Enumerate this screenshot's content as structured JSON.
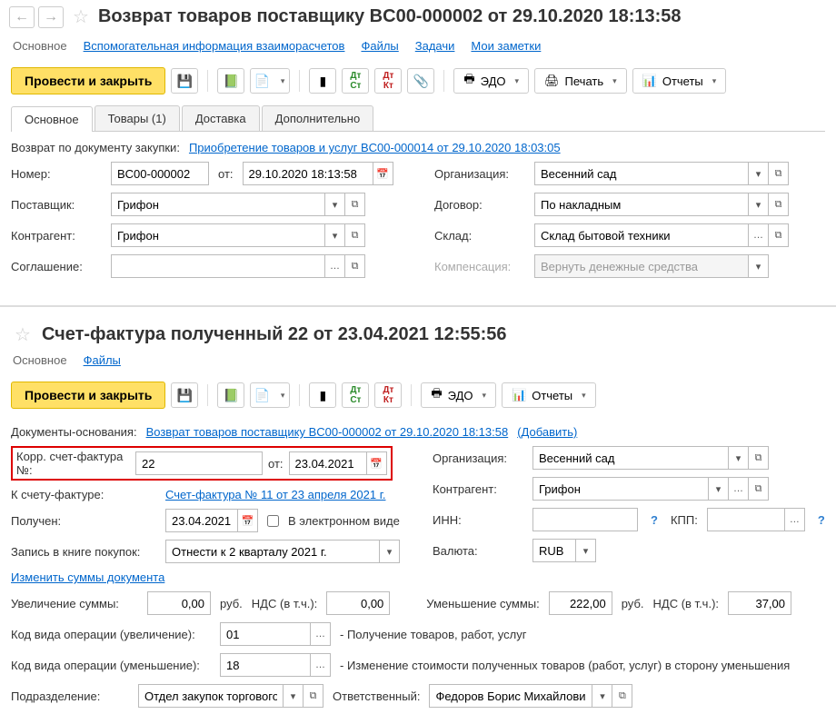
{
  "doc1": {
    "title": "Возврат товаров поставщику BC00-000002 от 29.10.2020 18:13:58",
    "hlinks": {
      "main": "Основное",
      "aux": "Вспомогательная информация взаиморасчетов",
      "files": "Файлы",
      "tasks": "Задачи",
      "notes": "Мои заметки"
    },
    "toolbar": {
      "postclose": "Провести и закрыть",
      "edo": "ЭДО",
      "print": "Печать",
      "reports": "Отчеты"
    },
    "tabs": {
      "main": "Основное",
      "goods": "Товары (1)",
      "delivery": "Доставка",
      "extra": "Дополнительно"
    },
    "returnBy": {
      "label": "Возврат по документу закупки:",
      "link": "Приобретение товаров и услуг BC00-000014 от 29.10.2020 18:03:05"
    },
    "number": {
      "label": "Номер:",
      "value": "BC00-000002",
      "from": "от:",
      "date": "29.10.2020 18:13:58"
    },
    "org": {
      "label": "Организация:",
      "value": "Весенний сад"
    },
    "supplier": {
      "label": "Поставщик:",
      "value": "Грифон"
    },
    "contract": {
      "label": "Договор:",
      "value": "По накладным"
    },
    "counter": {
      "label": "Контрагент:",
      "value": "Грифон"
    },
    "warehouse": {
      "label": "Склад:",
      "value": "Склад бытовой техники"
    },
    "agreement": {
      "label": "Соглашение:"
    },
    "compensation": {
      "label": "Компенсация:",
      "value": "Вернуть денежные средства"
    }
  },
  "doc2": {
    "title": "Счет-фактура полученный 22 от 23.04.2021 12:55:56",
    "hlinks": {
      "main": "Основное",
      "files": "Файлы"
    },
    "toolbar": {
      "postclose": "Провести и закрыть",
      "edo": "ЭДО",
      "reports": "Отчеты"
    },
    "basis": {
      "label": "Документы-основания:",
      "link": "Возврат товаров поставщику BC00-000002 от 29.10.2020 18:13:58",
      "add": "(Добавить)"
    },
    "corr": {
      "label": "Корр. счет-фактура №:",
      "num": "22",
      "from": "от:",
      "date": "23.04.2021"
    },
    "org": {
      "label": "Организация:",
      "value": "Весенний сад"
    },
    "toInvoice": {
      "label": "К счету-фактуре:",
      "link": "Счет-фактура № 11 от 23 апреля 2021 г."
    },
    "counter": {
      "label": "Контрагент:",
      "value": "Грифон"
    },
    "received": {
      "label": "Получен:",
      "date": "23.04.2021",
      "electronic": "В электронном виде"
    },
    "inn": {
      "label": "ИНН:",
      "kpp": "КПП:"
    },
    "book": {
      "label": "Запись в книге покупок:",
      "value": "Отнести к 2 кварталу 2021 г."
    },
    "currency": {
      "label": "Валюта:",
      "value": "RUB"
    },
    "changeSums": "Изменить суммы документа",
    "sums": {
      "incLabel": "Увеличение суммы:",
      "inc": "0,00",
      "rub": "руб.",
      "ndsLabel": "НДС (в т.ч.):",
      "incNds": "0,00",
      "decLabel": "Уменьшение суммы:",
      "dec": "222,00",
      "decNds": "37,00"
    },
    "opInc": {
      "label": "Код вида операции (увеличение):",
      "code": "01",
      "desc": "- Получение товаров, работ, услуг"
    },
    "opDec": {
      "label": "Код вида операции (уменьшение):",
      "code": "18",
      "desc": "- Изменение стоимости полученных товаров (работ, услуг) в сторону уменьшения"
    },
    "dept": {
      "label": "Подразделение:",
      "value": "Отдел закупок торгового на"
    },
    "resp": {
      "label": "Ответственный:",
      "value": "Федоров Борис Михайлович"
    }
  }
}
